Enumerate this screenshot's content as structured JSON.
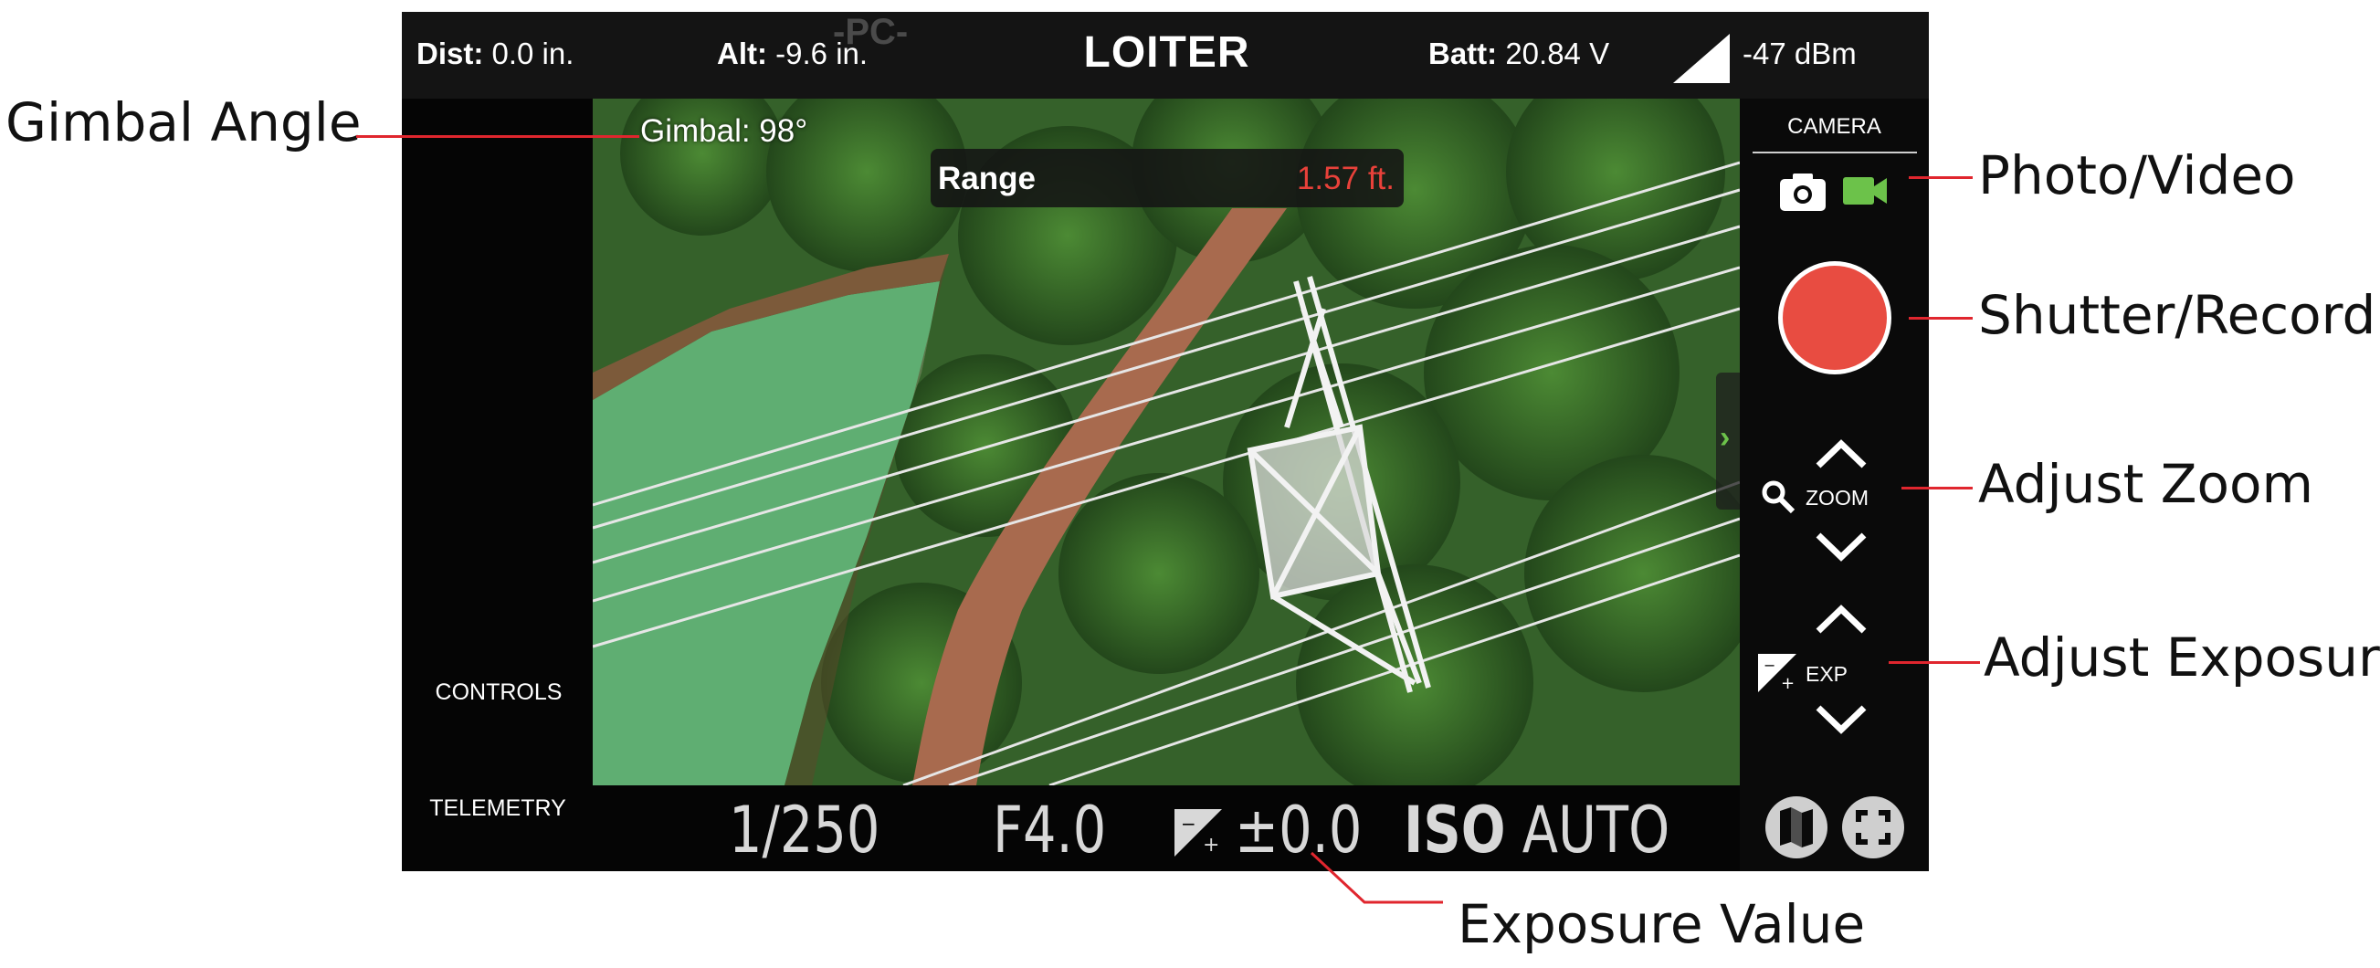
{
  "topbar": {
    "dist_label": "Dist:",
    "dist_value": "0.0 in.",
    "alt_label": "Alt:",
    "alt_value": "-9.6 in.",
    "mode": "LOITER",
    "pc_tag": "-PC-",
    "batt_label": "Batt:",
    "batt_value": "20.84 V",
    "signal_icon": "signal-strength-icon",
    "signal_value": "-47 dBm"
  },
  "left_panel": {
    "controls_label": "CONTROLS",
    "telemetry_label": "TELEMETRY"
  },
  "feed": {
    "gimbal": "Gimbal: 98°",
    "range_label": "Range",
    "range_value": "1.57 ft.",
    "range_color": "#e8413a",
    "handle_icon": "chevron-right-icon"
  },
  "camera_panel": {
    "title": "CAMERA",
    "photo_icon": "camera-icon",
    "video_icon": "video-camera-icon",
    "video_active_color": "#6cc24a",
    "shutter_color": "#e84c41",
    "zoom_label": "ZOOM",
    "zoom_icon": "magnifier-icon",
    "exp_label": "EXP",
    "exp_icon": "exposure-compensation-icon",
    "map_icon": "map-icon",
    "fullscreen_icon": "fullscreen-icon"
  },
  "exposure_bar": {
    "shutter_speed": "1/250",
    "aperture": "F4.0",
    "ev": "±0.0",
    "iso_label": "ISO",
    "iso_value": "AUTO"
  },
  "callouts": {
    "gimbal_angle": "Gimbal Angle",
    "photo_video": "Photo/Video",
    "shutter_record": "Shutter/Record",
    "adjust_zoom": "Adjust Zoom",
    "adjust_exposure": "Adjust Exposure",
    "exposure_value": "Exposure Value",
    "leader_color": "#e0262e"
  }
}
